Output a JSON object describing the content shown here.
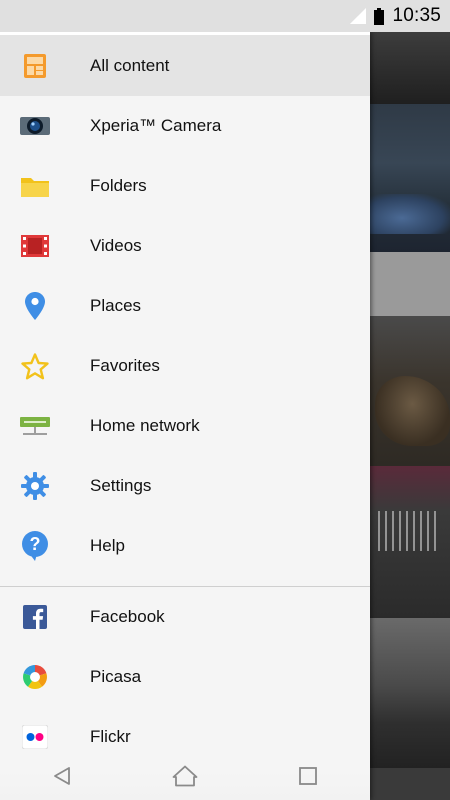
{
  "status_bar": {
    "time": "10:35",
    "icons": [
      "signal-icon",
      "battery-icon"
    ]
  },
  "drawer": {
    "items": [
      {
        "label": "All content",
        "icon": "all-content-icon",
        "active": true
      },
      {
        "label": "Xperia™ Camera",
        "icon": "camera-icon",
        "active": false
      },
      {
        "label": "Folders",
        "icon": "folder-icon",
        "active": false
      },
      {
        "label": "Videos",
        "icon": "film-icon",
        "active": false
      },
      {
        "label": "Places",
        "icon": "map-pin-icon",
        "active": false
      },
      {
        "label": "Favorites",
        "icon": "star-icon",
        "active": false
      },
      {
        "label": "Home network",
        "icon": "home-network-icon",
        "active": false
      },
      {
        "label": "Settings",
        "icon": "gear-icon",
        "active": false
      },
      {
        "label": "Help",
        "icon": "help-icon",
        "active": false
      }
    ],
    "services": [
      {
        "label": "Facebook",
        "icon": "facebook-icon"
      },
      {
        "label": "Picasa",
        "icon": "picasa-icon"
      },
      {
        "label": "Flickr",
        "icon": "flickr-icon"
      }
    ]
  },
  "nav_bar": {
    "buttons": [
      "back-icon",
      "home-icon",
      "recents-icon"
    ]
  },
  "colors": {
    "drawer_bg": "#f5f5f5",
    "active_bg": "#e4e4e4",
    "status_bar_bg": "#e0e0e0",
    "accent_blue": "#3f8ee5",
    "accent_orange": "#f49a2c",
    "folder_yellow": "#f2c21b",
    "video_red": "#e0393a",
    "facebook_blue": "#3b5998",
    "flickr_pink": "#ff0084",
    "flickr_blue": "#0063dc"
  }
}
